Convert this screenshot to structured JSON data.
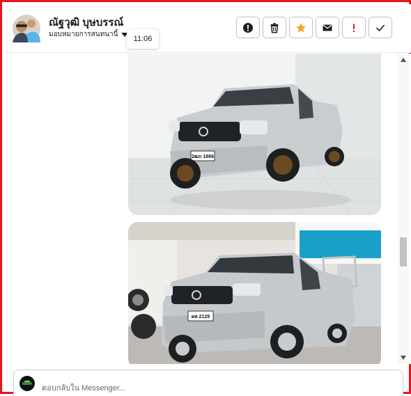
{
  "header": {
    "contact_name": "ณัฐวุฒิ บุษบรรณ์",
    "assign_label": "มอบหมายการสนทนานี้",
    "message_time": "11:06",
    "avatar_icon": "person-avatar",
    "actions": [
      {
        "name": "info-button",
        "icon": "info-icon"
      },
      {
        "name": "delete-button",
        "icon": "trash-icon"
      },
      {
        "name": "star-button",
        "icon": "star-icon",
        "color": "#f5a623"
      },
      {
        "name": "mail-button",
        "icon": "envelope-icon"
      },
      {
        "name": "follow-up-button",
        "icon": "exclamation-icon",
        "color": "#e8141b"
      },
      {
        "name": "done-button",
        "icon": "check-icon"
      }
    ]
  },
  "messages": [
    {
      "type": "image",
      "plate_text": "2ฒก 1886"
    },
    {
      "type": "image",
      "plate_text": "ผท 2129"
    }
  ],
  "reply": {
    "placeholder": "ตอบกลับใน Messenger..."
  },
  "colors": {
    "frame": "#e8141b",
    "star": "#f5a623",
    "flag": "#e8141b"
  }
}
